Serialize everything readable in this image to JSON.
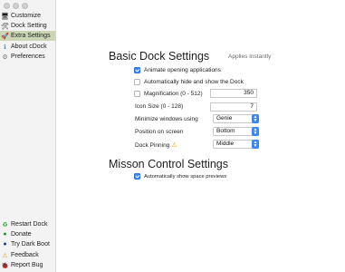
{
  "sidebar": {
    "items": [
      {
        "label": "Customize",
        "icon": "monitor-icon",
        "glyph": "🖥"
      },
      {
        "label": "Dock Setting",
        "icon": "tools-icon",
        "glyph": "🛠"
      },
      {
        "label": "Extra Settings",
        "icon": "rocket-icon",
        "glyph": "🚀"
      },
      {
        "label": "About cDock",
        "icon": "info-icon",
        "glyph": "ℹ"
      },
      {
        "label": "Preferences",
        "icon": "gear-icon",
        "glyph": "⚙"
      }
    ],
    "selected_index": 2,
    "bottom_items": [
      {
        "label": "Restart Dock",
        "icon": "recycle-icon",
        "glyph": "♻"
      },
      {
        "label": "Donate",
        "icon": "donate-icon",
        "glyph": "●"
      },
      {
        "label": "Try Dark Boot",
        "icon": "dark-boot-icon",
        "glyph": "●"
      },
      {
        "label": "Feedback",
        "icon": "warning-icon",
        "glyph": "⚠"
      },
      {
        "label": "Report Bug",
        "icon": "bug-icon",
        "glyph": "🐞"
      }
    ]
  },
  "basic": {
    "title": "Basic Dock Settings",
    "hint": "Applies Instantly",
    "animate_label": "Animate opening applications",
    "animate_checked": true,
    "autohide_label": "Automatically hide and show the Dock",
    "autohide_checked": false,
    "magnification_label": "Magnification (0 - 512)",
    "magnification_checked": false,
    "magnification_value": "350",
    "icon_size_label": "Icon Size (0 - 128)",
    "icon_size_value": "7",
    "minimize_label": "Minimize windows using",
    "minimize_value": "Genie",
    "position_label": "Position on screen",
    "position_value": "Bottom",
    "pinning_label": "Dock Pinning",
    "pinning_value": "Middle"
  },
  "mission": {
    "title": "Misson Control Settings",
    "previews_label": "Automatically show space previews",
    "previews_checked": true
  },
  "colors": {
    "accent": "#3b86f7",
    "sidebar_selected": "#cbd6b7",
    "warning": "#e0a400"
  }
}
